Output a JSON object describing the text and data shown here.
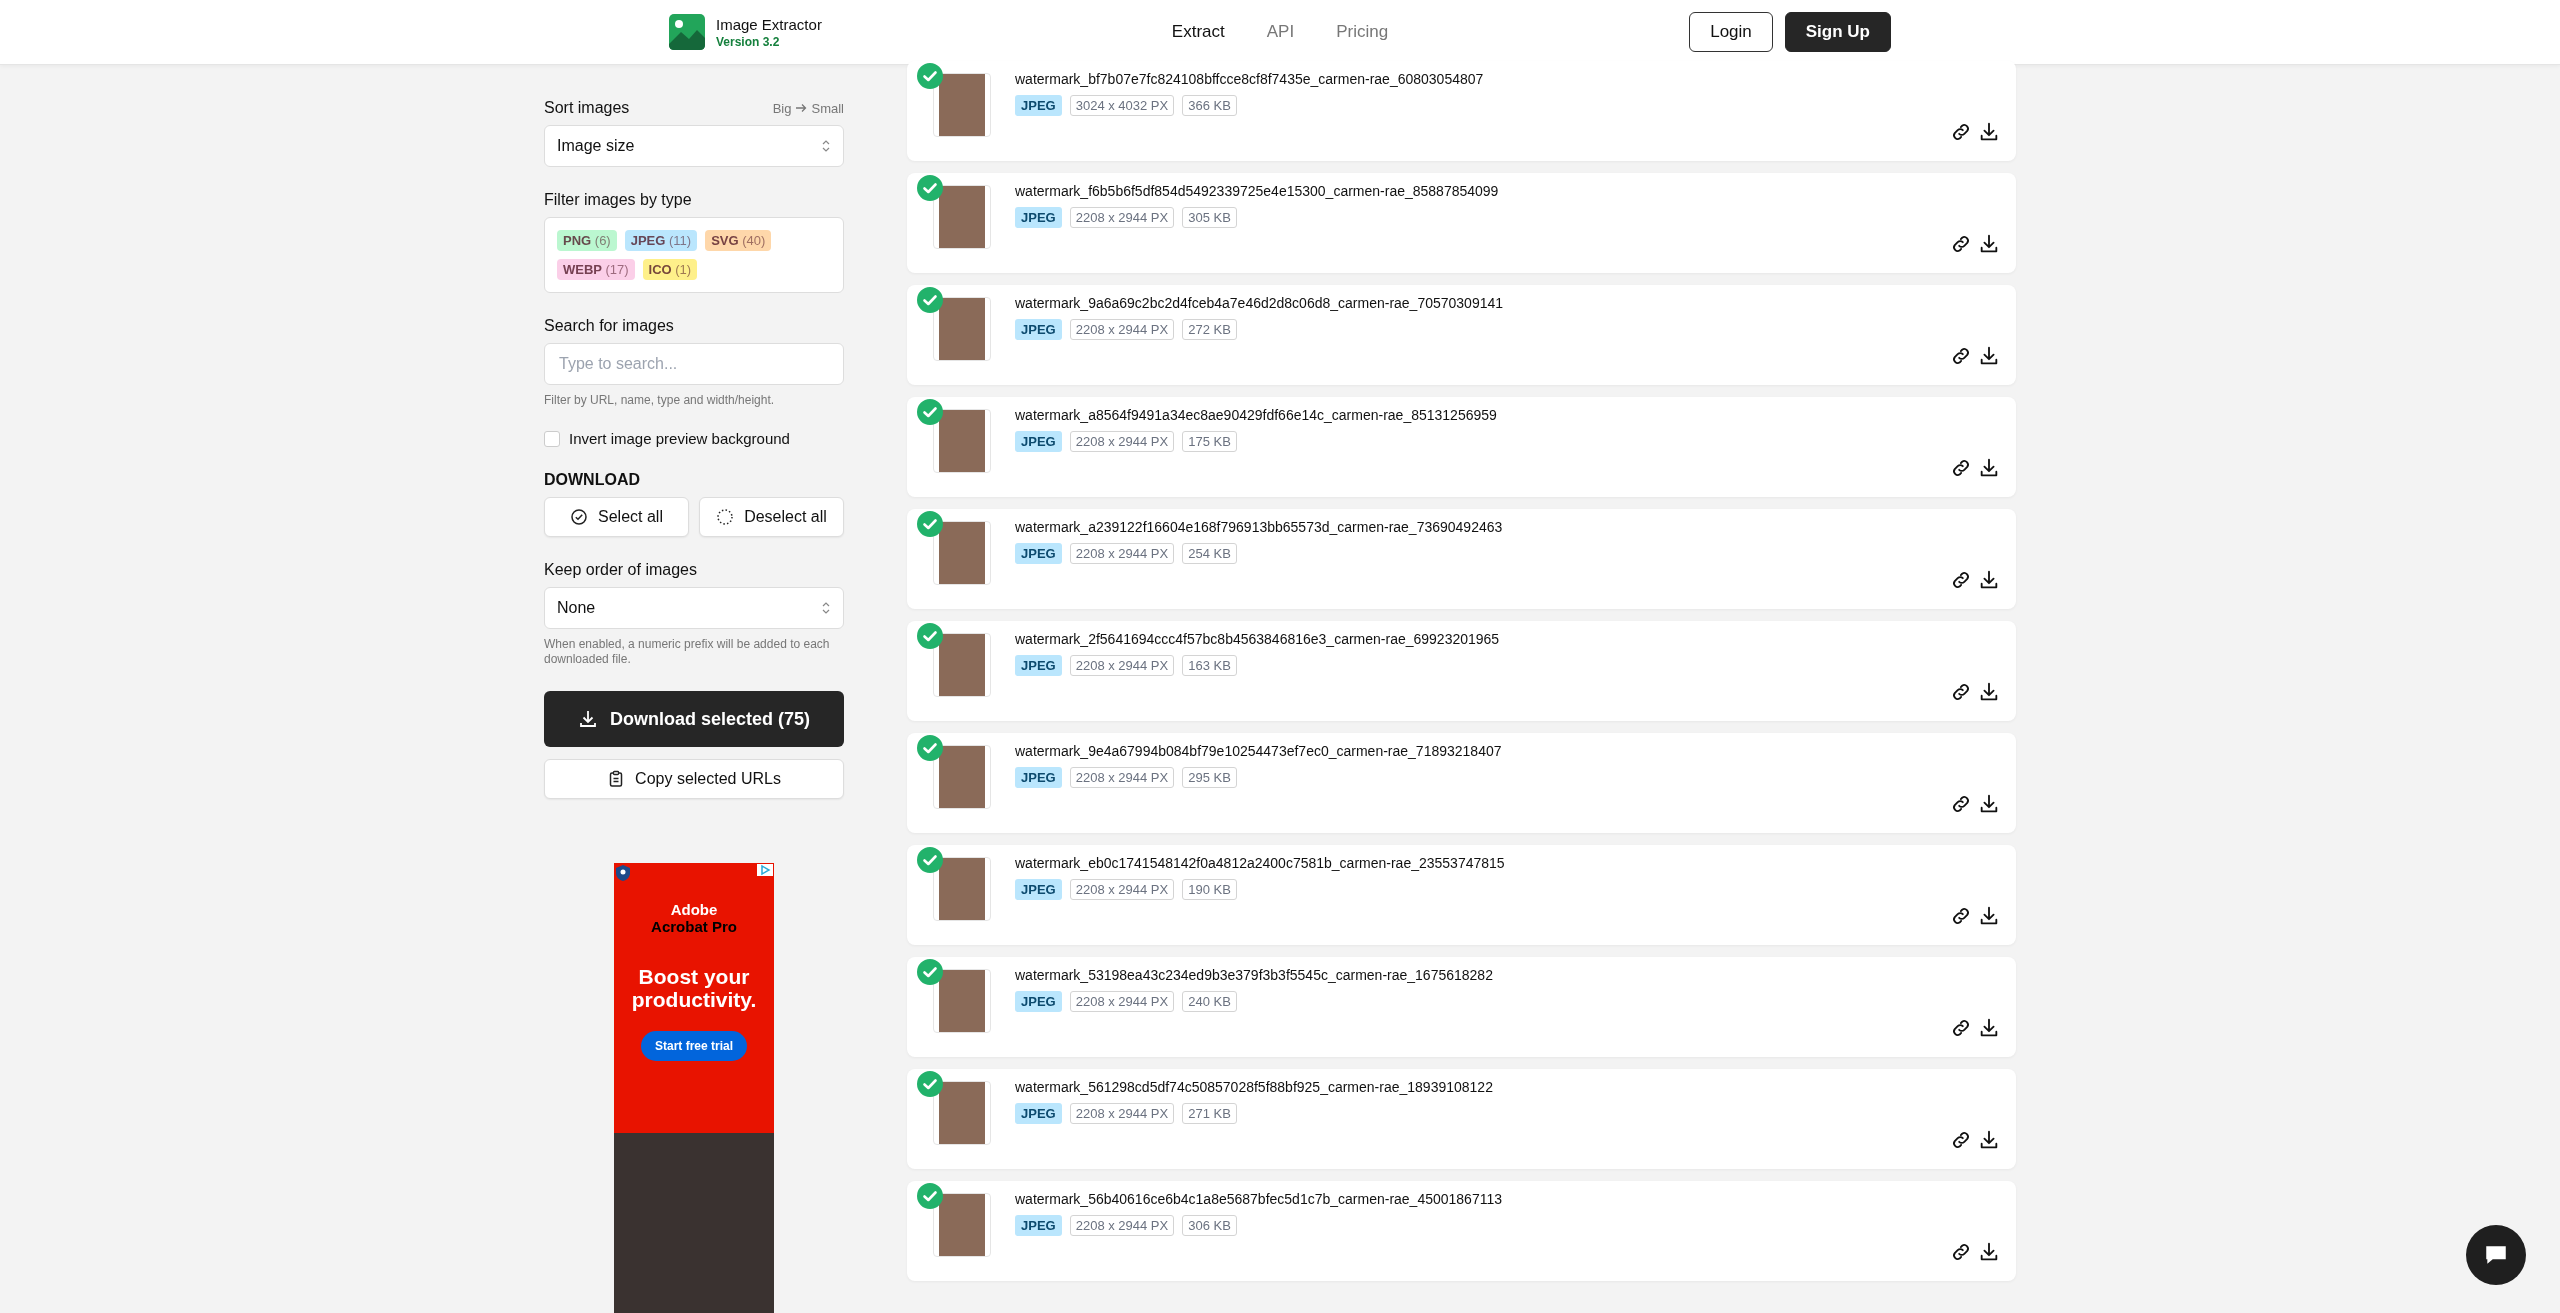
{
  "header": {
    "app_name": "Image Extractor",
    "version": "Version 3.2",
    "nav": [
      {
        "label": "Extract",
        "selected": true
      },
      {
        "label": "API",
        "selected": false
      },
      {
        "label": "Pricing",
        "selected": false
      }
    ],
    "login": "Login",
    "signup": "Sign Up"
  },
  "sidebar": {
    "sort": {
      "label": "Sort images",
      "hint_from": "Big",
      "hint_to": "Small",
      "value": "Image size"
    },
    "filter": {
      "label": "Filter images by type",
      "tags": [
        {
          "label": "PNG",
          "count": "(6)",
          "color": "#bbf7d0"
        },
        {
          "label": "JPEG",
          "count": "(11)",
          "color": "#bae6fd"
        },
        {
          "label": "SVG",
          "count": "(40)",
          "color": "#fed7aa"
        },
        {
          "label": "WEBP",
          "count": "(17)",
          "color": "#fbcfe8"
        },
        {
          "label": "ICO",
          "count": "(1)",
          "color": "#fef08a"
        }
      ]
    },
    "search": {
      "label": "Search for images",
      "placeholder": "Type to search...",
      "help": "Filter by URL, name, type and width/height."
    },
    "invert": {
      "label": "Invert image preview background",
      "checked": false
    },
    "download": {
      "heading": "DOWNLOAD",
      "select_all": "Select all",
      "deselect_all": "Deselect all"
    },
    "order": {
      "label": "Keep order of images",
      "value": "None",
      "help": "When enabled, a numeric prefix will be added to each downloaded file."
    },
    "download_button": "Download selected (75)",
    "copy_button": "Copy selected URLs"
  },
  "ad": {
    "brand": "Adobe",
    "product": "Acrobat Pro",
    "headline": "Boost your productivity.",
    "cta": "Start free trial"
  },
  "images": [
    {
      "filename": "watermark_bf7b07e7fc824108bffcce8cf8f7435e_carmen-rae_60803054807",
      "type": "JPEG",
      "dimensions": "3024 x 4032 PX",
      "size": "366 KB",
      "selected": true
    },
    {
      "filename": "watermark_f6b5b6f5df854d5492339725e4e15300_carmen-rae_85887854099",
      "type": "JPEG",
      "dimensions": "2208 x 2944 PX",
      "size": "305 KB",
      "selected": true
    },
    {
      "filename": "watermark_9a6a69c2bc2d4fceb4a7e46d2d8c06d8_carmen-rae_70570309141",
      "type": "JPEG",
      "dimensions": "2208 x 2944 PX",
      "size": "272 KB",
      "selected": true
    },
    {
      "filename": "watermark_a8564f9491a34ec8ae90429fdf66e14c_carmen-rae_85131256959",
      "type": "JPEG",
      "dimensions": "2208 x 2944 PX",
      "size": "175 KB",
      "selected": true
    },
    {
      "filename": "watermark_a239122f16604e168f796913bb65573d_carmen-rae_73690492463",
      "type": "JPEG",
      "dimensions": "2208 x 2944 PX",
      "size": "254 KB",
      "selected": true
    },
    {
      "filename": "watermark_2f5641694ccc4f57bc8b4563846816e3_carmen-rae_69923201965",
      "type": "JPEG",
      "dimensions": "2208 x 2944 PX",
      "size": "163 KB",
      "selected": true
    },
    {
      "filename": "watermark_9e4a67994b084bf79e10254473ef7ec0_carmen-rae_71893218407",
      "type": "JPEG",
      "dimensions": "2208 x 2944 PX",
      "size": "295 KB",
      "selected": true
    },
    {
      "filename": "watermark_eb0c1741548142f0a4812a2400c7581b_carmen-rae_23553747815",
      "type": "JPEG",
      "dimensions": "2208 x 2944 PX",
      "size": "190 KB",
      "selected": true
    },
    {
      "filename": "watermark_53198ea43c234ed9b3e379f3b3f5545c_carmen-rae_1675618282",
      "type": "JPEG",
      "dimensions": "2208 x 2944 PX",
      "size": "240 KB",
      "selected": true
    },
    {
      "filename": "watermark_561298cd5df74c50857028f5f88bf925_carmen-rae_18939108122",
      "type": "JPEG",
      "dimensions": "2208 x 2944 PX",
      "size": "271 KB",
      "selected": true
    },
    {
      "filename": "watermark_56b40616ce6b4c1a8e5687bfec5d1c7b_carmen-rae_45001867113",
      "type": "JPEG",
      "dimensions": "2208 x 2944 PX",
      "size": "306 KB",
      "selected": true
    }
  ]
}
